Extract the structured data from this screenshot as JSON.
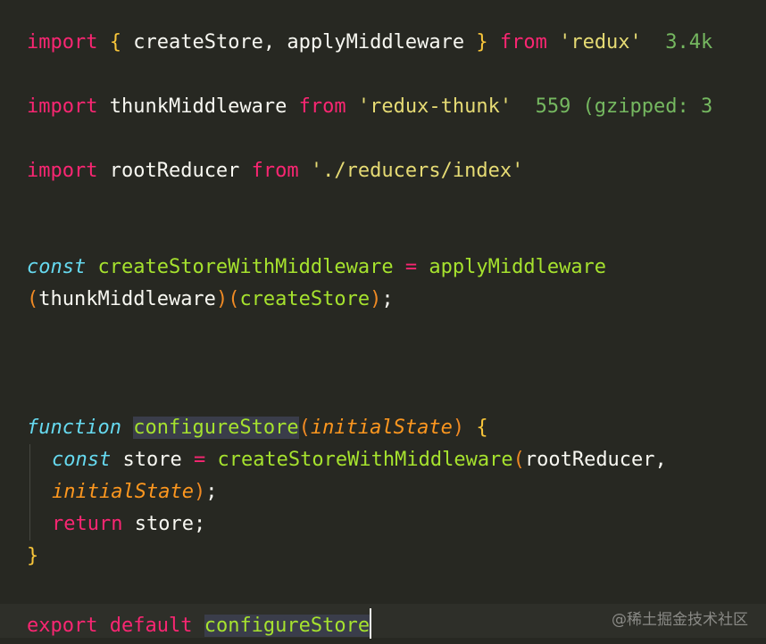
{
  "code": {
    "line1": {
      "import_kw": "import",
      "open_brace": "{",
      "names": " createStore, applyMiddleware ",
      "close_brace": "}",
      "from_kw": "from",
      "module": "'redux'",
      "size_hint": "3.4k"
    },
    "line2": {
      "import_kw": "import",
      "name": " thunkMiddleware ",
      "from_kw": "from",
      "module": "'redux-thunk'",
      "size_hint": "559 (gzipped: 3"
    },
    "line3": {
      "import_kw": "import",
      "name": " rootReducer ",
      "from_kw": "from",
      "module": "'./reducers/index'"
    },
    "line4": {
      "const_kw": "const",
      "var_name": "createStoreWithMiddleware",
      "op": "=",
      "call": "applyMiddleware"
    },
    "line5": {
      "open_paren": "(",
      "arg1": "thunkMiddleware",
      "close_paren": ")",
      "open_paren2": "(",
      "arg2": "createStore",
      "close_paren2": ")",
      "semicolon": ";"
    },
    "line6": {
      "function_kw": "function",
      "fn_name": "configureStore",
      "open_paren": "(",
      "param": "initialState",
      "close_paren": ")",
      "open_brace": "{"
    },
    "line7": {
      "const_kw": "const",
      "var_name": " store ",
      "op": "=",
      "call": "createStoreWithMiddleware",
      "open_paren": "(",
      "arg": "rootReducer,"
    },
    "line8": {
      "param": "initialState",
      "close_paren": ")",
      "semicolon": ";"
    },
    "line9": {
      "return_kw": "return",
      "value": " store;"
    },
    "line10": {
      "close_brace": "}"
    },
    "line11": {
      "export_kw": "export",
      "default_kw": "default",
      "name": "configureStore"
    }
  },
  "watermark": "@稀土掘金技术社区",
  "colors": {
    "background": "#272822",
    "keyword": "#f92672",
    "string": "#e6db74",
    "storage": "#66d9ef",
    "function_name": "#a6e22e",
    "parameter": "#fd971f",
    "size_hint": "#75b860",
    "text": "#f8f8f2"
  }
}
